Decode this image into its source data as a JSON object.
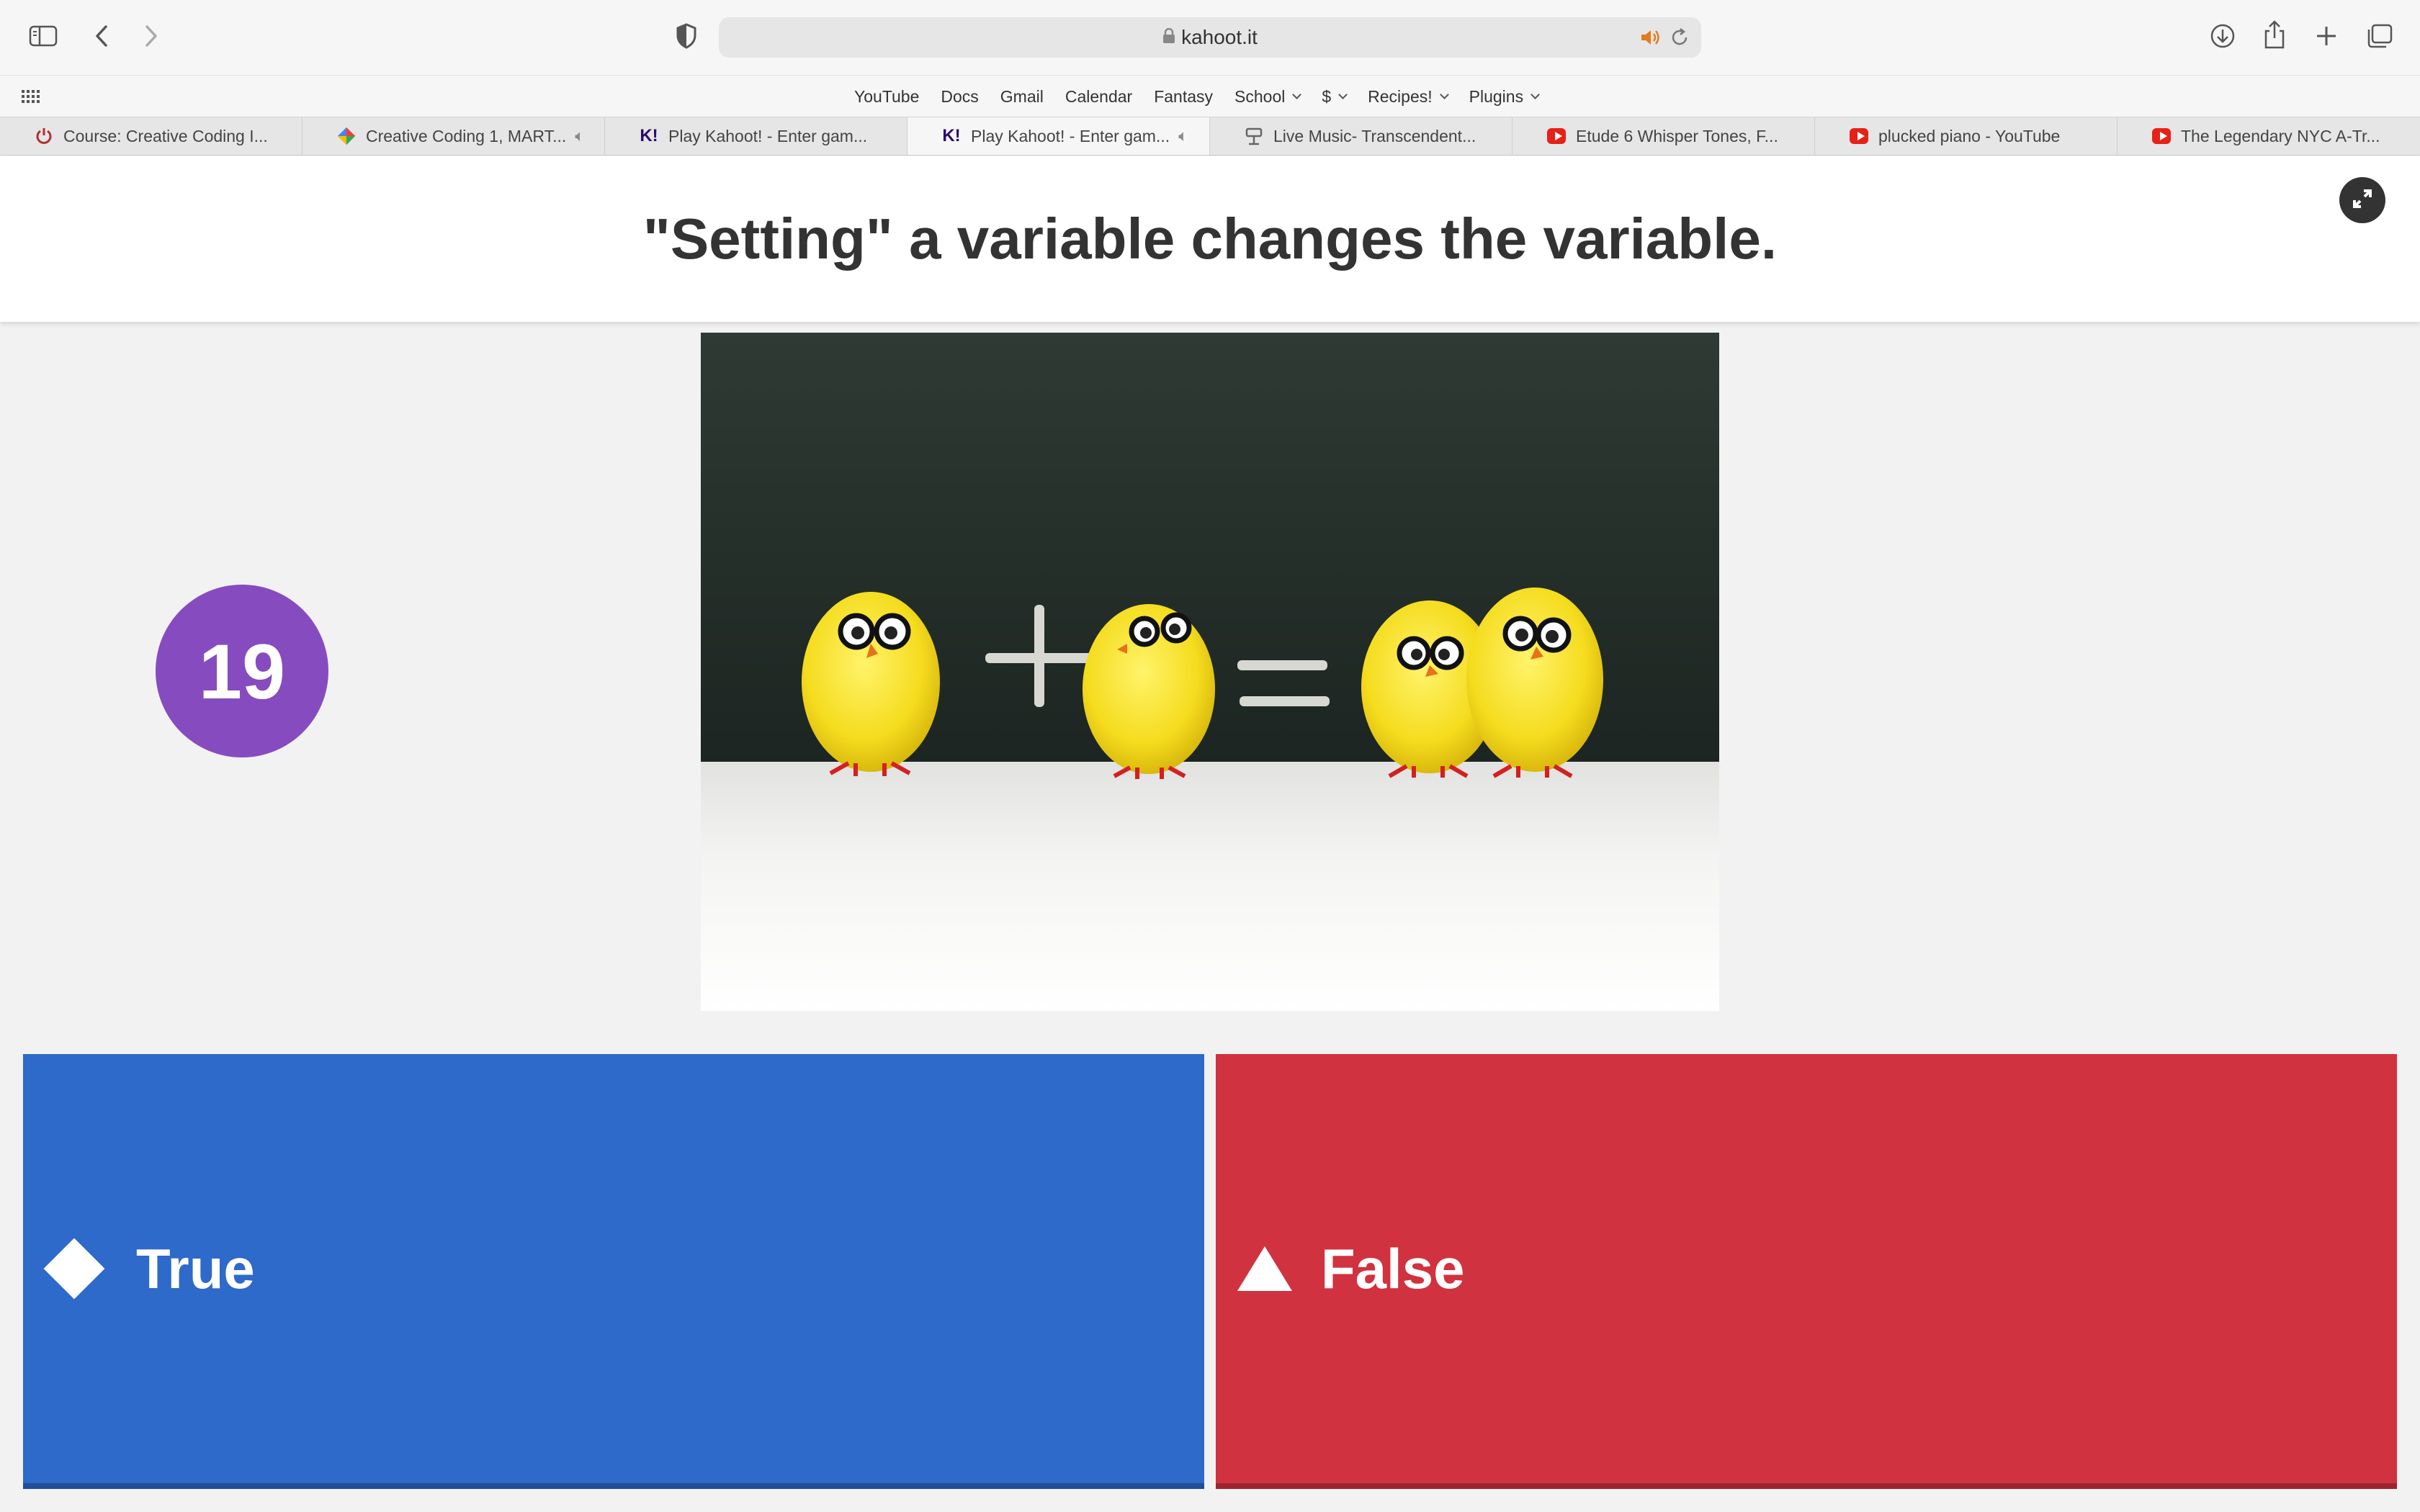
{
  "browser": {
    "url": "kahoot.it",
    "favorites": [
      {
        "label": "YouTube",
        "dropdown": false
      },
      {
        "label": "Docs",
        "dropdown": false
      },
      {
        "label": "Gmail",
        "dropdown": false
      },
      {
        "label": "Calendar",
        "dropdown": false
      },
      {
        "label": "Fantasy",
        "dropdown": false
      },
      {
        "label": "School",
        "dropdown": true
      },
      {
        "label": "$",
        "dropdown": true
      },
      {
        "label": "Recipes!",
        "dropdown": true
      },
      {
        "label": "Plugins",
        "dropdown": true
      }
    ],
    "tabs": [
      {
        "title": "Course: Creative Coding I...",
        "icon": "power-icon",
        "audio": false,
        "active": false
      },
      {
        "title": "Creative Coding 1, MART...",
        "icon": "colorful-diamond-icon",
        "audio": true,
        "active": false
      },
      {
        "title": "Play Kahoot! - Enter gam...",
        "icon": "kahoot-icon",
        "audio": false,
        "active": false
      },
      {
        "title": "Play Kahoot! - Enter gam...",
        "icon": "kahoot-icon",
        "audio": true,
        "active": true
      },
      {
        "title": "Live Music- Transcendent...",
        "icon": "music-stand-icon",
        "audio": false,
        "active": false
      },
      {
        "title": "Etude 6 Whisper Tones, F...",
        "icon": "youtube-icon",
        "audio": false,
        "active": false
      },
      {
        "title": "plucked piano - YouTube",
        "icon": "youtube-icon",
        "audio": false,
        "active": false
      },
      {
        "title": "The Legendary NYC A-Tr...",
        "icon": "youtube-icon",
        "audio": false,
        "active": false
      }
    ]
  },
  "kahoot": {
    "question": "\"Setting\" a variable changes the variable.",
    "timer": "19",
    "image_icon": "chicks-math-image",
    "answers": [
      {
        "label": "True",
        "shape": "diamond-icon",
        "color": "#2d6ac9"
      },
      {
        "label": "False",
        "shape": "triangle-icon",
        "color": "#d1323f"
      }
    ]
  },
  "colors": {
    "timer": "#864cbf",
    "true": "#2d6ac9",
    "false": "#d1323f",
    "background": "#f2f2f2"
  }
}
